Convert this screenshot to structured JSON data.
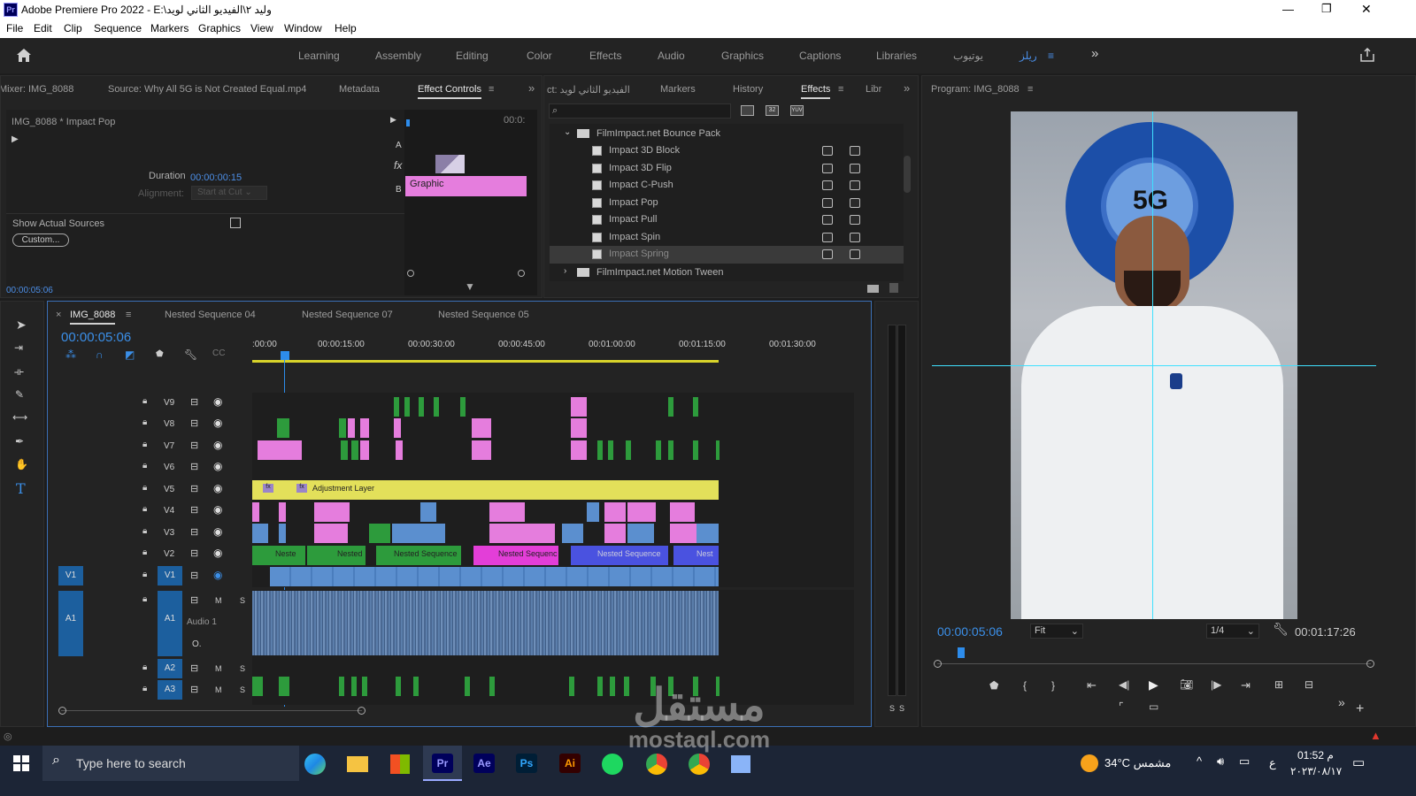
{
  "window": {
    "title": "Adobe Premiere Pro 2022 - E:\\وليد ٢\\الفيديو الثاني لويد",
    "app_icon": "Pr",
    "min": "—",
    "max": "❐",
    "close": "✕"
  },
  "menu": [
    "File",
    "Edit",
    "Clip",
    "Sequence",
    "Markers",
    "Graphics",
    "View",
    "Window",
    "Help"
  ],
  "workspaces": [
    "Learning",
    "Assembly",
    "Editing",
    "Color",
    "Effects",
    "Audio",
    "Graphics",
    "Captions",
    "Libraries",
    "يوتيوب",
    "ريلز"
  ],
  "source_panel": {
    "tabs": [
      "Mixer: IMG_8088",
      "Source: Why All 5G is Not Created Equal.mp4",
      "Metadata",
      "Effect Controls"
    ],
    "clip_label": "IMG_8088 * Impact Pop",
    "time_header": "00:0:",
    "duration_label": "Duration",
    "duration_value": "00:00:00:15",
    "alignment_label": "Alignment:",
    "alignment_value": "Start at Cut",
    "show_sources": "Show Actual Sources",
    "custom_button": "Custom...",
    "a_label": "A",
    "b_label": "B",
    "fx_label": "fx",
    "graphic_clip": "Graphic",
    "timecode": "00:00:05:06"
  },
  "effects_panel": {
    "tabs": [
      "ct: الفيديو الثاني لويد",
      "Markers",
      "History",
      "Effects",
      "Libr"
    ],
    "folder1": "FilmImpact.net Bounce Pack",
    "items": [
      "Impact 3D Block",
      "Impact 3D Flip",
      "Impact C-Push",
      "Impact Pop",
      "Impact Pull",
      "Impact Spin",
      "Impact Spring"
    ],
    "folder2": "FilmImpact.net Motion Tween"
  },
  "program_panel": {
    "title": "Program: IMG_8088",
    "timecode": "00:00:05:06",
    "fit": "Fit",
    "quality": "1/4",
    "duration": "00:01:17:26",
    "overlay_text": "5G"
  },
  "timeline": {
    "tabs": [
      "IMG_8088",
      "Nested Sequence 04",
      "Nested Sequence 07",
      "Nested Sequence 05"
    ],
    "timecode": "00:00:05:06",
    "ruler": [
      ":00:00",
      "00:00:15:00",
      "00:00:30:00",
      "00:00:45:00",
      "00:01:00:00",
      "00:01:15:00",
      "00:01:30:00"
    ],
    "tracks_video": [
      "V9",
      "V8",
      "V7",
      "V6",
      "V5",
      "V4",
      "V3",
      "V2",
      "V1"
    ],
    "tracks_audio": [
      "A1",
      "A2",
      "A3"
    ],
    "source_v1": "V1",
    "source_a1": "A1",
    "audio1_name": "Audio 1",
    "adjustment_layer": "Adjustment Layer",
    "nested_labels": [
      "Neste",
      "Nested",
      "Nested Sequence",
      "Nested Sequenc",
      "Nested Sequence",
      "Nest"
    ],
    "m": "M",
    "s": "S",
    "meter_labels": [
      "S",
      "S"
    ]
  },
  "taskbar": {
    "search_placeholder": "Type here to search",
    "apps": [
      "Pr",
      "Ae",
      "Ps",
      "Ai"
    ],
    "weather": "34°C  مشمس",
    "time": "01:52 م",
    "date": "٢٠٢٣/٠٨/١٧",
    "lang": "ع"
  },
  "watermark": {
    "arabic": "مستقل",
    "latin": "mostaql.com"
  }
}
